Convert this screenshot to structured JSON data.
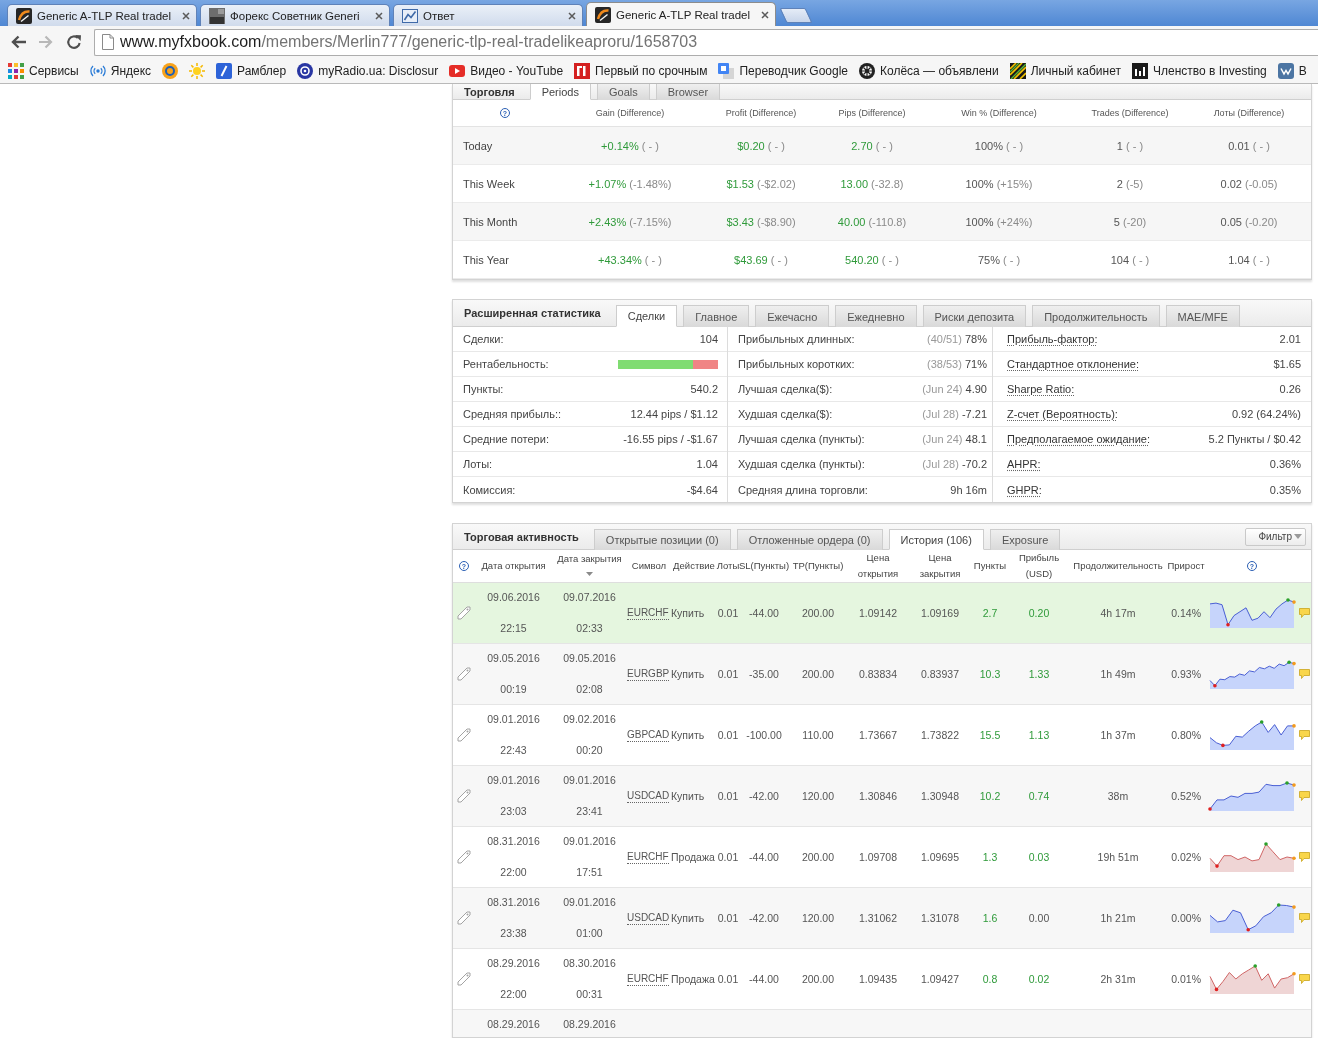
{
  "browser": {
    "tabs": [
      {
        "title": "Generic A-TLP Real tradel",
        "selected": false
      },
      {
        "title": "Форекс Советник Generi",
        "selected": false
      },
      {
        "title": "Ответ",
        "selected": false
      },
      {
        "title": "Generic A-TLP Real tradel",
        "selected": true
      }
    ],
    "address": {
      "host": "www.myfxbook.com",
      "path": "/members/Merlin777/generic-tlp-real-tradelikeaproru/1658703"
    },
    "bookmarks": [
      {
        "kind": "link",
        "label": "Сервисы"
      },
      {
        "kind": "link",
        "label": "Яндекс"
      },
      {
        "kind": "icon"
      },
      {
        "kind": "icon"
      },
      {
        "kind": "link",
        "label": "Рамблер"
      },
      {
        "kind": "link",
        "label": "myRadio.ua: Disclosur"
      },
      {
        "kind": "link",
        "label": "Видео - YouTube"
      },
      {
        "kind": "link",
        "label": "Первый по срочным"
      },
      {
        "kind": "link",
        "label": "Переводчик Google"
      },
      {
        "kind": "link",
        "label": "Колёса — объявлени"
      },
      {
        "kind": "link",
        "label": "Личный кабинет"
      },
      {
        "kind": "link",
        "label": "Членство в Investing"
      },
      {
        "kind": "link",
        "label": "В"
      }
    ]
  },
  "trading": {
    "title": "Торговля",
    "tabs": [
      {
        "label": "Periods",
        "selected": true
      },
      {
        "label": "Goals",
        "selected": false
      },
      {
        "label": "Browser",
        "selected": false
      }
    ],
    "help_mark": "?",
    "columns": [
      {
        "label": "Gain (Difference)",
        "positive": true
      },
      {
        "label": "Profit (Difference)",
        "positive": true
      },
      {
        "label": "Pips (Difference)",
        "positive": true
      },
      {
        "label": "Win % (Difference)",
        "positive": false
      },
      {
        "label": "Trades (Difference)",
        "positive": false
      },
      {
        "label": "Лоты (Difference)",
        "positive": false
      }
    ],
    "rows": [
      {
        "period": "Today",
        "cells": [
          {
            "value": "+0.14%",
            "difference": "( - )"
          },
          {
            "value": "$0.20",
            "difference": "( - )"
          },
          {
            "value": "2.70",
            "difference": "( - )"
          },
          {
            "value": "100%",
            "difference": "( - )"
          },
          {
            "value": "1",
            "difference": "( - )"
          },
          {
            "value": "0.01",
            "difference": "( - )"
          }
        ]
      },
      {
        "period": "This Week",
        "cells": [
          {
            "value": "+1.07%",
            "difference": "(-1.48%)"
          },
          {
            "value": "$1.53",
            "difference": "(-$2.02)"
          },
          {
            "value": "13.00",
            "difference": "(-32.8)"
          },
          {
            "value": "100%",
            "difference": "(+15%)"
          },
          {
            "value": "2",
            "difference": "(-5)"
          },
          {
            "value": "0.02",
            "difference": "(-0.05)"
          }
        ]
      },
      {
        "period": "This Month",
        "cells": [
          {
            "value": "+2.43%",
            "difference": "(-7.15%)"
          },
          {
            "value": "$3.43",
            "difference": "(-$8.90)"
          },
          {
            "value": "40.00",
            "difference": "(-110.8)"
          },
          {
            "value": "100%",
            "difference": "(+24%)"
          },
          {
            "value": "5",
            "difference": "(-20)"
          },
          {
            "value": "0.05",
            "difference": "(-0.20)"
          }
        ]
      },
      {
        "period": "This Year",
        "cells": [
          {
            "value": "+43.34%",
            "difference": "( - )"
          },
          {
            "value": "$43.69",
            "difference": "( - )"
          },
          {
            "value": "540.20",
            "difference": "( - )"
          },
          {
            "value": "75%",
            "difference": "( - )"
          },
          {
            "value": "104",
            "difference": "( - )"
          },
          {
            "value": "1.04",
            "difference": "( - )"
          }
        ]
      }
    ]
  },
  "extended_stats": {
    "title": "Расширенная статистика",
    "tabs": [
      {
        "label": "Сделки",
        "selected": true
      },
      {
        "label": "Главное",
        "selected": false
      },
      {
        "label": "Ежечасно",
        "selected": false
      },
      {
        "label": "Ежедневно",
        "selected": false
      },
      {
        "label": "Риски депозита",
        "selected": false
      },
      {
        "label": "Продолжительность",
        "selected": false
      },
      {
        "label": "MAE/MFE",
        "selected": false
      }
    ],
    "columns": [
      {
        "rows": [
          {
            "kind": "text",
            "label": "Сделки:",
            "value": "104"
          },
          {
            "kind": "bar",
            "label": "Рентабельность:",
            "level": 0.75
          },
          {
            "kind": "text",
            "label": "Пункты:",
            "value": "540.2"
          },
          {
            "kind": "text",
            "label": "Средняя прибыль::",
            "value": "12.44 pips / $1.12"
          },
          {
            "kind": "text",
            "label": "Средние потери:",
            "value": "-16.55 pips / -$1.67"
          },
          {
            "kind": "text",
            "label": "Лоты:",
            "value": "1.04"
          },
          {
            "kind": "text",
            "label": "Комиссия:",
            "value": "-$4.64"
          }
        ]
      },
      {
        "rows": [
          {
            "kind": "text",
            "label": "Прибыльных длинных:",
            "note": "(40/51)",
            "value": "78%"
          },
          {
            "kind": "text",
            "label": "Прибыльных коротких:",
            "note": "(38/53)",
            "value": "71%"
          },
          {
            "kind": "text",
            "label": "Лучшая сделка($):",
            "note": "(Jun 24)",
            "value": "4.90"
          },
          {
            "kind": "text",
            "label": "Худшая сделка($):",
            "note": "(Jul 28)",
            "value": "-7.21"
          },
          {
            "kind": "text",
            "label": "Лучшая сделка (пункты):",
            "note": "(Jun 24)",
            "value": "48.1"
          },
          {
            "kind": "text",
            "label": "Худшая сделка (пункты):",
            "note": "(Jul 28)",
            "value": "-70.2"
          },
          {
            "kind": "text",
            "label": "Средняя длина торговли:",
            "value": "9h 16m"
          }
        ]
      },
      {
        "rows": [
          {
            "kind": "hint",
            "label": "Прибыль-фактор:",
            "value": "2.01"
          },
          {
            "kind": "hint",
            "label": "Стандартное отклонение:",
            "value": "$1.65"
          },
          {
            "kind": "hint",
            "label": "Sharpe Ratio:",
            "value": "0.26"
          },
          {
            "kind": "hint",
            "label": "Z-счет (Вероятность):",
            "value": "0.92 (64.24%)"
          },
          {
            "kind": "hint",
            "label": "Предполагаемое ожидание:",
            "value": "5.2 Пункты / $0.42"
          },
          {
            "kind": "hint",
            "label": "AHPR:",
            "value": "0.36%"
          },
          {
            "kind": "hint",
            "label": "GHPR:",
            "value": "0.35%"
          }
        ]
      }
    ]
  },
  "activity": {
    "title": "Торговая активность",
    "tabs": [
      {
        "label": "Открытые позиции (0)",
        "selected": false
      },
      {
        "label": "Отложенные ордера (0)",
        "selected": false
      },
      {
        "label": "История (106)",
        "selected": true
      },
      {
        "label": "Exposure",
        "selected": false
      }
    ],
    "filter": "Фильтр",
    "help_marks": [
      "?",
      "?"
    ],
    "columns": [
      {
        "label": "Дата открытия",
        "sorted": false
      },
      {
        "label": "Дата закрытия",
        "sorted": true
      },
      {
        "label": "Символ",
        "sorted": false
      },
      {
        "label": "Действие",
        "sorted": false
      },
      {
        "label": "Лоты",
        "sorted": false
      },
      {
        "label": "SL(Пункты)",
        "sorted": false
      },
      {
        "label": "TP(Пункты)",
        "sorted": false
      },
      {
        "label": "Цена открытия",
        "sorted": false
      },
      {
        "label": "Цена закрытия",
        "sorted": false
      },
      {
        "label": "Пункты",
        "sorted": false
      },
      {
        "label": "Прибыль (USD)",
        "sorted": false
      },
      {
        "label": "Продолжительность",
        "sorted": false
      },
      {
        "label": "Прирост",
        "sorted": false
      }
    ],
    "rows": [
      {
        "selected": true,
        "kind": "buy",
        "open_date": "09.06.2016",
        "open_time": "22:15",
        "close_date": "09.07.2016",
        "close_time": "02:33",
        "symbol": "EURCHF",
        "action": "Купить",
        "lots": "0.01",
        "sl": "-44.00",
        "tp": "200.00",
        "open_price": "1.09142",
        "close_price": "1.09169",
        "pips": {
          "value": "2.7",
          "positive": true
        },
        "profit": {
          "value": "0.20",
          "positive": true
        },
        "duration": "4h 17m",
        "gain": "0.14%"
      },
      {
        "selected": false,
        "kind": "buy",
        "open_date": "09.05.2016",
        "open_time": "00:19",
        "close_date": "09.05.2016",
        "close_time": "02:08",
        "symbol": "EURGBP",
        "action": "Купить",
        "lots": "0.01",
        "sl": "-35.00",
        "tp": "200.00",
        "open_price": "0.83834",
        "close_price": "0.83937",
        "pips": {
          "value": "10.3",
          "positive": true
        },
        "profit": {
          "value": "1.33",
          "positive": true
        },
        "duration": "1h 49m",
        "gain": "0.93%"
      },
      {
        "selected": false,
        "kind": "buy",
        "open_date": "09.01.2016",
        "open_time": "22:43",
        "close_date": "09.02.2016",
        "close_time": "00:20",
        "symbol": "GBPCAD",
        "action": "Купить",
        "lots": "0.01",
        "sl": "-100.00",
        "tp": "110.00",
        "open_price": "1.73667",
        "close_price": "1.73822",
        "pips": {
          "value": "15.5",
          "positive": true
        },
        "profit": {
          "value": "1.13",
          "positive": true
        },
        "duration": "1h 37m",
        "gain": "0.80%"
      },
      {
        "selected": false,
        "kind": "buy",
        "open_date": "09.01.2016",
        "open_time": "23:03",
        "close_date": "09.01.2016",
        "close_time": "23:41",
        "symbol": "USDCAD",
        "action": "Купить",
        "lots": "0.01",
        "sl": "-42.00",
        "tp": "120.00",
        "open_price": "1.30846",
        "close_price": "1.30948",
        "pips": {
          "value": "10.2",
          "positive": true
        },
        "profit": {
          "value": "0.74",
          "positive": true
        },
        "duration": "38m",
        "gain": "0.52%"
      },
      {
        "selected": false,
        "kind": "sell",
        "open_date": "08.31.2016",
        "open_time": "22:00",
        "close_date": "09.01.2016",
        "close_time": "17:51",
        "symbol": "EURCHF",
        "action": "Продажа",
        "lots": "0.01",
        "sl": "-44.00",
        "tp": "200.00",
        "open_price": "1.09708",
        "close_price": "1.09695",
        "pips": {
          "value": "1.3",
          "positive": true
        },
        "profit": {
          "value": "0.03",
          "positive": true
        },
        "duration": "19h 51m",
        "gain": "0.02%"
      },
      {
        "selected": false,
        "kind": "buy",
        "open_date": "08.31.2016",
        "open_time": "23:38",
        "close_date": "09.01.2016",
        "close_time": "01:00",
        "symbol": "USDCAD",
        "action": "Купить",
        "lots": "0.01",
        "sl": "-42.00",
        "tp": "120.00",
        "open_price": "1.31062",
        "close_price": "1.31078",
        "pips": {
          "value": "1.6",
          "positive": true
        },
        "profit": {
          "value": "0.00",
          "positive": false
        },
        "duration": "1h 21m",
        "gain": "0.00%"
      },
      {
        "selected": false,
        "kind": "sell",
        "open_date": "08.29.2016",
        "open_time": "22:00",
        "close_date": "08.30.2016",
        "close_time": "00:31",
        "symbol": "EURCHF",
        "action": "Продажа",
        "lots": "0.01",
        "sl": "-44.00",
        "tp": "200.00",
        "open_price": "1.09435",
        "close_price": "1.09427",
        "pips": {
          "value": "0.8",
          "positive": true
        },
        "profit": {
          "value": "0.02",
          "positive": true
        },
        "duration": "2h 31m",
        "gain": "0.01%"
      },
      {
        "selected": false,
        "open_date": "08.29.2016",
        "close_date": "08.29.2016"
      }
    ]
  }
}
